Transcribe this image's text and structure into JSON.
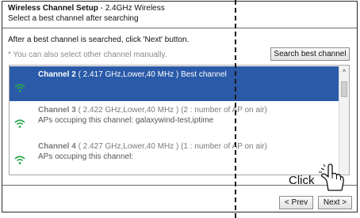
{
  "header": {
    "title_bold": "Wireless Channel Setup",
    "title_rest": " - 2.4GHz Wireless",
    "subtitle": "Select a best channel after searching"
  },
  "instructions": {
    "info": "After a best channel is searched, click 'Next' button.",
    "hint": "* You can also select other channel manually."
  },
  "search_button": "Search best channel",
  "channels": [
    {
      "name": "Channel 2",
      "details": " ( 2.417 GHz,Lower,40 MHz )  Best channel",
      "aps": "",
      "selected": true,
      "icon": "wifi-signal-icon"
    },
    {
      "name": "Channel 3",
      "details": " ( 2.422 GHz,Lower,40 MHz )  (2 : number of AP on air)",
      "aps": "APs occuping this channel: galaxywind-test,iptime",
      "selected": false,
      "icon": "wifi-signal-icon"
    },
    {
      "name": "Channel 4",
      "details": " ( 2.427 GHz,Lower,40 MHz )  (1 : number of AP on air)",
      "aps": "APs occuping this channel:",
      "selected": false,
      "icon": "wifi-signal-icon"
    }
  ],
  "scrollbar": {
    "up_glyph": "^"
  },
  "nav": {
    "prev": "< Prev",
    "next": "Next >"
  },
  "annotation": {
    "click": "Click"
  },
  "colors": {
    "selected_row": "#2a5aa8",
    "wifi_green": "#2aa84a"
  }
}
